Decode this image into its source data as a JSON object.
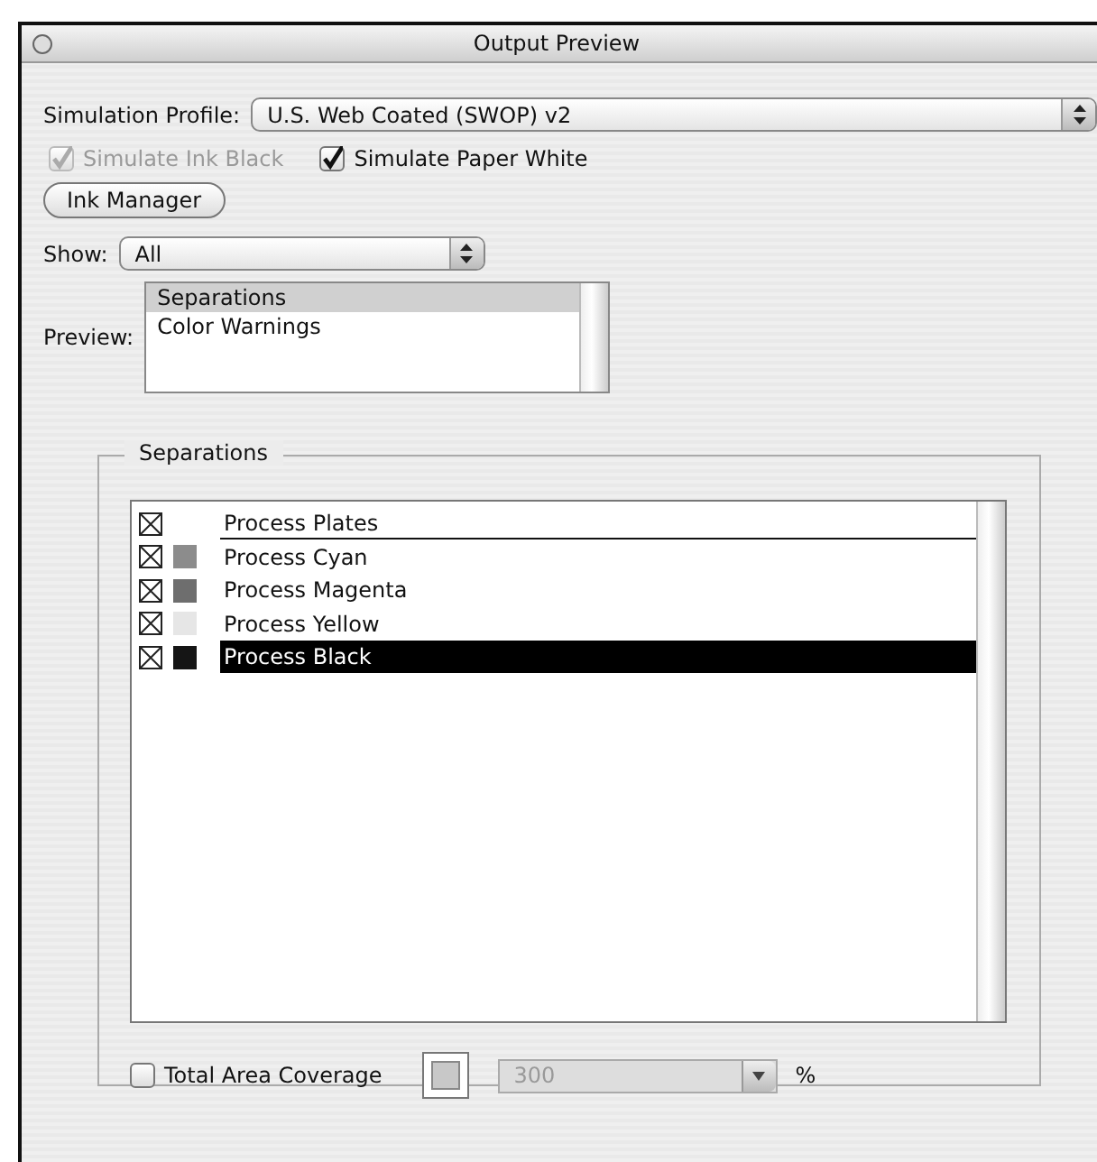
{
  "window": {
    "title": "Output Preview"
  },
  "simulation_profile": {
    "label": "Simulation Profile:",
    "value": "U.S. Web Coated (SWOP) v2"
  },
  "options": [
    {
      "label": "Simulate Ink Black",
      "checked": true,
      "disabled": true
    },
    {
      "label": "Simulate Paper White",
      "checked": true,
      "disabled": false
    }
  ],
  "ink_manager_button": "Ink Manager",
  "show": {
    "label": "Show:",
    "value": "All"
  },
  "preview": {
    "label": "Preview:",
    "items": [
      {
        "label": "Separations",
        "selected": true
      },
      {
        "label": "Color Warnings",
        "selected": false
      }
    ]
  },
  "separations": {
    "title": "Separations",
    "items": [
      {
        "kind": "composite",
        "label": "Process Plates",
        "checked": true,
        "selected": false
      },
      {
        "kind": "ink",
        "label": "Process Cyan",
        "checked": true,
        "color": "#8c8c8c",
        "selected": false
      },
      {
        "kind": "ink",
        "label": "Process Magenta",
        "checked": true,
        "color": "#6e6e6e",
        "selected": false
      },
      {
        "kind": "ink",
        "label": "Process Yellow",
        "checked": true,
        "color": "#e6e6e6",
        "selected": false
      },
      {
        "kind": "ink",
        "label": "Process Black",
        "checked": true,
        "color": "#151515",
        "selected": true
      }
    ]
  },
  "total_area_coverage": {
    "label": "Total Area Coverage",
    "checked": false,
    "value": "300",
    "value_disabled": true,
    "unit": "%"
  }
}
